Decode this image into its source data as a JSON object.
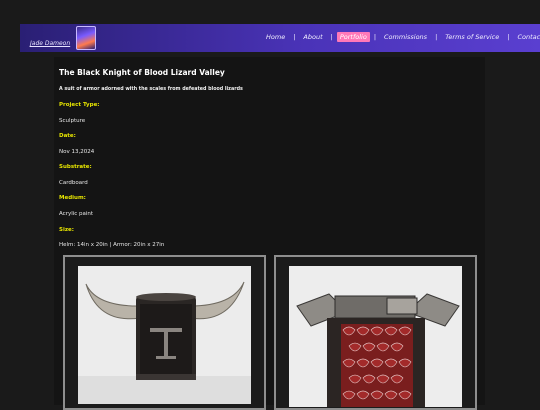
{
  "header": {
    "site_name": "Jade Dameon",
    "nav": [
      {
        "label": "Home"
      },
      {
        "label": "About"
      },
      {
        "label": "Portfolio",
        "active": true
      },
      {
        "label": "Commissions"
      },
      {
        "label": "Terms of Service"
      },
      {
        "label": "Contact"
      }
    ],
    "colors": {
      "nav_start": "#2a1f74",
      "nav_end": "#5a3fd0",
      "active": "#ff78b8",
      "label": "#e8e600"
    }
  },
  "project": {
    "title": "The Black Knight of Blood Lizard Valley",
    "subtitle": "A suit of armor adorned with the scales from defeated blood lizards",
    "fields": [
      {
        "label": "Project Type:",
        "value": "Sculpture"
      },
      {
        "label": "Date:",
        "value": "Nov 13,2024"
      },
      {
        "label": "Substrate:",
        "value": "Cardboard"
      },
      {
        "label": "Medium:",
        "value": "Acrylic paint"
      },
      {
        "label": "Size:",
        "value": "Helm: 14in x 20in | Armor: 20in x 27in"
      }
    ]
  },
  "gallery": [
    {
      "name": "helm-photo"
    },
    {
      "name": "armor-photo"
    }
  ]
}
